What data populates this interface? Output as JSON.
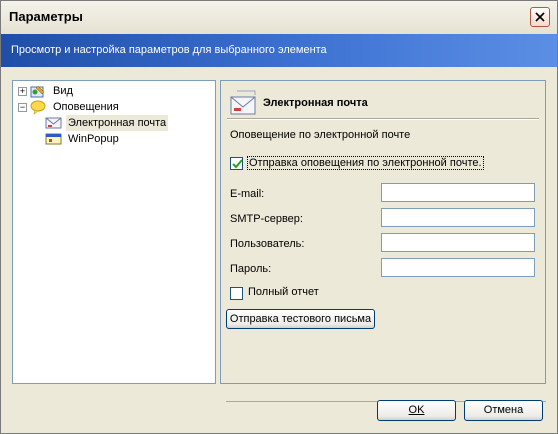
{
  "window": {
    "title": "Параметры"
  },
  "banner": {
    "text": "Просмотр и настройка параметров для выбранного элемента"
  },
  "tree": {
    "items": [
      {
        "label": "Вид",
        "icon": "view-icon",
        "expander": "+"
      },
      {
        "label": "Оповещения",
        "icon": "notifications-icon",
        "expander": "−"
      },
      {
        "label": "Электронная почта",
        "icon": "email-icon",
        "selected": true
      },
      {
        "label": "WinPopup",
        "icon": "winpopup-icon"
      }
    ]
  },
  "panel": {
    "title": "Электронная почта",
    "subtitle": "Оповещение по электронной почте",
    "send_notification": {
      "label": "Отправка оповещения по электронной почте.",
      "checked": true
    },
    "fields": [
      {
        "label": "E-mail:",
        "value": ""
      },
      {
        "label": "SMTP-сервер:",
        "value": ""
      },
      {
        "label": "Пользователь:",
        "value": ""
      },
      {
        "label": "Пароль:",
        "value": ""
      }
    ],
    "full_report": {
      "label": "Полный отчет",
      "checked": false
    },
    "test_button": "Отправка тестового письма"
  },
  "buttons": {
    "ok": "OK",
    "cancel": "Отмена"
  },
  "colors": {
    "banner": "#2b5fc2",
    "tree_border": "#7f9db9",
    "button_border": "#003c74",
    "check": "#21a121"
  }
}
